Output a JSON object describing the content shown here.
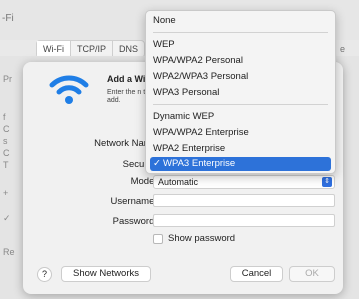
{
  "bg": {
    "title": "-Fi",
    "tabs": [
      "Wi-Fi",
      "TCP/IP",
      "DNS",
      "e"
    ],
    "left_labels": [
      "Pr",
      "Re"
    ],
    "left_marks": [
      "f",
      "C",
      "s",
      "C",
      "T",
      "+",
      "✓"
    ]
  },
  "dialog": {
    "title": "Add a Wi",
    "description": "Enter the n to add.",
    "network_name_label": "Network Name",
    "security_label": "Security",
    "mode_label": "Mode:",
    "mode_value": "Automatic",
    "username_label": "Username:",
    "username_value": "",
    "password_label": "Password:",
    "password_value": "",
    "show_password_label": "Show password",
    "help_label": "?",
    "show_networks_label": "Show Networks",
    "cancel_label": "Cancel",
    "ok_label": "OK"
  },
  "security_menu": {
    "items": [
      {
        "label": "None"
      },
      {
        "label": "WEP"
      },
      {
        "label": "WPA/WPA2 Personal"
      },
      {
        "label": "WPA2/WPA3 Personal"
      },
      {
        "label": "WPA3 Personal"
      },
      {
        "label": "Dynamic WEP"
      },
      {
        "label": "WPA/WPA2 Enterprise"
      },
      {
        "label": "WPA2 Enterprise"
      },
      {
        "label": "WPA3 Enterprise"
      }
    ],
    "selected": "WPA3 Enterprise",
    "check_glyph": "✓"
  },
  "colors": {
    "accent": "#2d72d9",
    "wifi_icon": "#1f7ee6"
  }
}
